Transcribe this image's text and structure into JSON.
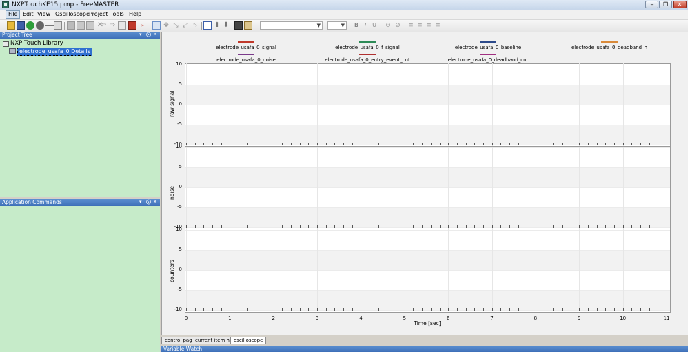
{
  "window": {
    "title": "NXPTouchKE15.pmp - FreeMASTER",
    "controls": {
      "minimize": "–",
      "restore": "❐",
      "close": "✕"
    }
  },
  "menu": [
    "File",
    "Edit",
    "View",
    "Oscilloscope",
    "Project",
    "Tools",
    "Help"
  ],
  "toolbar": {
    "icons": [
      "open-folder-icon",
      "save-icon",
      "record-icon",
      "stop-icon",
      "link-icon",
      "properties-icon",
      "cut-icon",
      "copy-icon",
      "paste-icon",
      "delete-icon",
      "back-icon",
      "forward-icon",
      "page-icon",
      "chip-icon",
      "run-icon",
      "cursor-icon",
      "pan-icon",
      "zoom-icon",
      "zoom-out-icon",
      "zoom-in-icon",
      "chart-icon",
      "up-arrow-icon",
      "down-arrow-icon",
      "camera-icon",
      "clipboard-icon"
    ],
    "format": {
      "bold": "B",
      "italic": "I",
      "underline": "U"
    }
  },
  "project_tree": {
    "header": "Project Tree",
    "root": "NXP Touch Library",
    "child": "electrode_usafa_0 Details"
  },
  "app_commands": {
    "header": "Application Commands"
  },
  "pane_controls": {
    "dropdown": "▾",
    "pin": "⨀",
    "close": "✕"
  },
  "chart_data": {
    "type": "line",
    "legend": [
      {
        "name": "electrode_usafa_0_signal",
        "color": "#c0392b"
      },
      {
        "name": "electrode_usafa_0_f_signal",
        "color": "#2e8b57"
      },
      {
        "name": "electrode_usafa_0_baseline",
        "color": "#2c4a8a"
      },
      {
        "name": "electrode_usafa_0_deadband_h",
        "color": "#d98a3a"
      },
      {
        "name": "electrode_usafa_0_noise",
        "color": "#7a3a8a"
      },
      {
        "name": "electrode_usafa_0_entry_event_cnt",
        "color": "#b03030"
      },
      {
        "name": "electrode_usafa_0_deadband_cnt",
        "color": "#a03080"
      }
    ],
    "plots": [
      {
        "ylabel": "raw signal",
        "ylim": [
          -10,
          10
        ],
        "yticks": [
          "10",
          "5",
          "0",
          "-5",
          "-10"
        ]
      },
      {
        "ylabel": "noise",
        "ylim": [
          -10,
          10
        ],
        "yticks": [
          "10",
          "5",
          "0",
          "-5",
          "-10"
        ]
      },
      {
        "ylabel": "counters",
        "ylim": [
          -10,
          10
        ],
        "yticks": [
          "10",
          "5",
          "0",
          "-5",
          "-10"
        ]
      }
    ],
    "xlabel": "Time [sec]",
    "xlim": [
      0,
      11
    ],
    "xticks": [
      "0",
      "1",
      "2",
      "3",
      "4",
      "5",
      "6",
      "7",
      "8",
      "9",
      "10",
      "11"
    ],
    "grid": true
  },
  "tabs": [
    "control page",
    "current item help",
    "oscilloscope"
  ],
  "bottom_pane": {
    "header": "Variable Watch"
  }
}
